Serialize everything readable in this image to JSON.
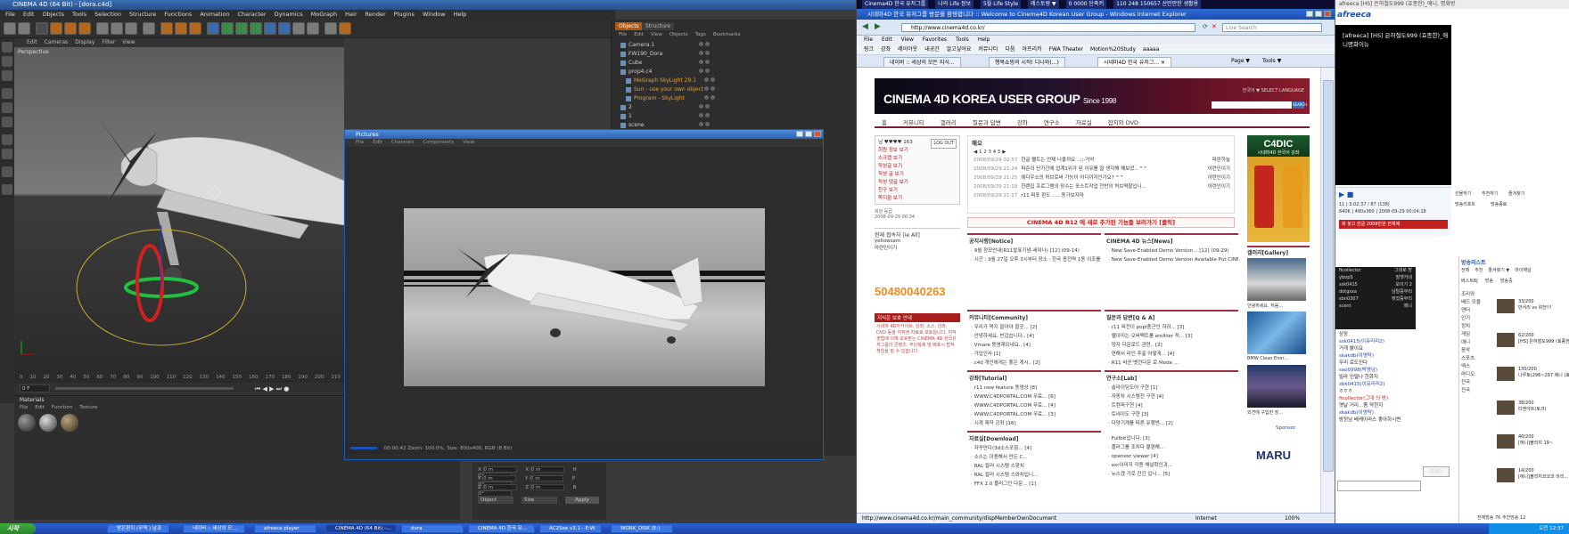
{
  "c4d": {
    "title": "CINEMA 4D (64 Bit) - [dora.c4d]",
    "menu": [
      "File",
      "Edit",
      "Objects",
      "Tools",
      "Selection",
      "Structure",
      "Functions",
      "Animation",
      "Character",
      "Dynamics",
      "MoGraph",
      "Hair",
      "Render",
      "Plugins",
      "Window",
      "Help"
    ],
    "viewport_menu": [
      "Edit",
      "Cameras",
      "Display",
      "Filter",
      "View"
    ],
    "viewport_label": "Perspective",
    "timeline_ticks": [
      "0",
      "10",
      "20",
      "30",
      "40",
      "50",
      "60",
      "70",
      "80",
      "90",
      "100",
      "110",
      "120",
      "130",
      "140",
      "150",
      "160",
      "170",
      "180",
      "190",
      "200",
      "210"
    ],
    "frame_value": "0 F",
    "materials_tab": "Materials",
    "materials_menu": [
      "File",
      "Edit",
      "Function",
      "Texture"
    ],
    "coords": {
      "rows": [
        [
          "X",
          "0 m",
          "X",
          "0 m",
          "H",
          "0°"
        ],
        [
          "Y",
          "0 m",
          "Y",
          "0 m",
          "P",
          "0°"
        ],
        [
          "Z",
          "0 m",
          "Z",
          "0 m",
          "B",
          "0°"
        ]
      ],
      "object_select": "Object",
      "size_select": "Size",
      "apply": "Apply"
    },
    "object_tabs": [
      "Objects",
      "Structure"
    ],
    "object_menu": [
      "File",
      "Edit",
      "View",
      "Objects",
      "Tags",
      "Bookmarks"
    ],
    "objects": [
      {
        "name": "Camera.1",
        "highlight": false
      },
      {
        "name": "FW190_Dora",
        "highlight": false
      },
      {
        "name": "Cube",
        "highlight": false
      },
      {
        "name": "prop4.c4",
        "highlight": false
      },
      {
        "name": "MoGraph SkyLight 29.1",
        "highlight": true
      },
      {
        "name": "Sun - use your own object",
        "highlight": true
      },
      {
        "name": "Program - SkyLight",
        "highlight": true
      },
      {
        "name": "2",
        "highlight": false
      },
      {
        "name": "1",
        "highlight": false
      },
      {
        "name": "scene",
        "highlight": false
      }
    ]
  },
  "pictures": {
    "title": "Pictures",
    "menu": [
      "File",
      "Edit",
      "Channels",
      "Components",
      "View"
    ],
    "status": "00:00:42    Zoom: 100.0%, Size: 800x400, RGB (8 Bit)"
  },
  "ie": {
    "topstrip": [
      "Cinema4D 한국 유저그룹",
      "나의 Life 정보",
      "5월 Life Style",
      "레스토랑 ▼",
      "0 0000 단축키",
      "110 248 150657 산만만한 생활용"
    ],
    "title": "시네마4D 한국 유저그룹 방문을 환영합니다 :: Welcome to Cinema4D Korean User Group - Windows Internet Explorer",
    "address": "http://www.cinema4d.co.kr/",
    "search_placeholder": "Live Search",
    "menu": [
      "File",
      "Edit",
      "View",
      "Favorites",
      "Tools",
      "Help"
    ],
    "favorites": [
      "링크",
      "강좌",
      "레이아웃",
      "내공간",
      "알고싶어요",
      "커뮤니티",
      "다음",
      "아프리카",
      "FWA Theater",
      "Motion%20Study",
      "aaaaa"
    ],
    "tabs": [
      "네이버 :: 세상의 모든 지식...",
      "행복쇼핑의 시작! 디나와(...)",
      "시네마4D 한국 유저그... ✕"
    ],
    "toolbar_right": [
      "Page ▼",
      "Tools ▼"
    ],
    "banner_title": "CINEMA 4D KOREA USER GROUP",
    "banner_since": "Since 1998",
    "banner_select": "한국어 ▼  SELECT LANGUAGE",
    "banner_go": "SEARCH",
    "nav": [
      "홈",
      "커뮤니티",
      "갤러리",
      "질문과 답변",
      "강좌",
      "연구소",
      "자료실",
      "잡지와 DVD"
    ],
    "login": {
      "user_label": "님 ♥♥♥♥ 163",
      "logout": "LOG OUT",
      "items": [
        "회원 정보 보기",
        "스크랩 보기",
        "작성글 보기",
        "작성 글 보기",
        "작성 댓글 보기",
        "친구 보기",
        "쪽지함 보기"
      ],
      "joined": "회원 등급",
      "joined_date": "2008-09-29 00:34"
    },
    "online_title": "현재 접속자 [ie All]",
    "online_users": [
      "yellowsam",
      "아련인이기"
    ],
    "counter": "50480040263",
    "youth_title": "지식은 보호 안내",
    "youth_text": "시네마 4D아카이브, 강좌, 소스, 강좌, DVD 등을 저작권 자료로 보호됩니다. 저작권법에 의해 보호받는 CINEMA 4D 한국유저그룹의 콘텐츠. 무단복제 및 배포시 법적 책임을 질 수 있습니다.",
    "notice": {
      "title": "해오",
      "pages": "◀ 1 2 3 4 5 ▶",
      "rows": [
        {
          "date": "2008/09/29 02:57",
          "text": "한글 펠트는 언제 나올까요 ..;;-거억",
          "author": "파란하늘"
        },
        {
          "date": "2008/09/29 21:24",
          "text": "파준이 단가간에 업계1위가 된 이유를 잘 생각해 해보셨.. ^^",
          "author": "아련인이기"
        },
        {
          "date": "2008/09/29 21:25",
          "text": "에디우소의 허브로써 가능이 어디까지인가요? ^^",
          "author": "아련인이기"
        },
        {
          "date": "2008/09/29 21:19",
          "text": "한랜집 프로그램의 장수는 포스트작업 전반의 허브역할입니...",
          "author": "아련인이기"
        },
        {
          "date": "2008/09/29 21:17",
          "text": "r11 퍼포 판도 ..... 동가보지마",
          "author": ""
        }
      ]
    },
    "red_banner": "CINEMA 4D R12 에 새로 추가된 기능들 보러가기 [클릭]",
    "boxes": [
      {
        "title": "공지사항[Notice]",
        "rows": [
          "9월 정모안내(R11발표기념-세미나) [12] (09-14)",
          "시간 : 9월 27일 오후 3시부터 장소 : 한국 종전략 1동 이조를 방문입니다 4번출구) 도보 5분.."
        ]
      },
      {
        "title": "CINEMA 4D 뉴스[News]",
        "rows": [
          "New Save-Enabled Demo Version... [12] (09-29)",
          "New Save-Enabled Demo Version Available Put CINEMA 4D R11 to..."
        ]
      },
      {
        "title": "커뮤니티[Community]",
        "rows": [
          "우리가 먹지 말아야 할곳... [2]",
          "안녕하세요, 반갑습니다.. [4]",
          "Vmare 동영재되네요.. [4]",
          "가입인사 [1]",
          "c4d 개인에게는 좋은 게시.. [2]"
        ]
      },
      {
        "title": "질문과 답변[Q & A]",
        "rows": [
          "r11 퍼전이 popl충근인 하려... [3]",
          "웹이미는 오버펙트를 emitter 적... [3]",
          "양자 다운로드 관련.. [2]",
          "연해서 라인 추출 어떻게... [4]",
          "R11 바꾼 뱃전다운 로 Mode ..."
        ]
      },
      {
        "title": "강좌[Tutorial]",
        "rows": [
          "r11 new feature 동영상 [8]",
          "WWW.C4DPORTAL.COM 무료... [6]",
          "WWW.C4DPORTAL.COM 무료... [4]",
          "WWW.C4DPORTAL.COM 무료... [3]",
          "시계 제작 강좌 [16]"
        ]
      },
      {
        "title": "연구소[Lab]",
        "rows": [
          "슬라이딩도어 구현 [1]",
          "자동차 시스템전 구현 [4]",
          "트렌퍼구현 [4]",
          "토네이도 구현 [3]",
          "다양기계를 따른 유행엔... [2]"
        ]
      },
      {
        "title": "자료실[Download]",
        "rows": [
          "자꾸만다(3d소스포함... [4]",
          "소스는 이용해서 만든 C... ",
          "RAL 컬러 시스템 스왓치",
          "RAL 컬러 시스템 스와치입니...",
          "FFX 2.0 플러그인 다운... [1]"
        ]
      },
      {
        "title": "",
        "rows": [
          "Fullbit입니다. [3]",
          "플러그를 조치다 불편해...",
          "openexr viewer [4]",
          "exr이미지 각종 채널확인과...",
          "뉴스겠 가로 간간 입니... [5]"
        ]
      }
    ],
    "c4dic_title": "C4DIC",
    "c4dic_sub": "시네마4D 한국어 강좌",
    "gallery_title": "갤러리[Gallery]",
    "gallery_captions": [
      "안녕하세요. 처음...",
      "BMW Clean Ener...",
      "외견에 구입한 장..."
    ],
    "sponsor": "Sponsor",
    "maru": "MARU",
    "status_url": "http://www.cinema4d.co.kr/main_community/dispMemberOwnDocument",
    "status_zone": "Internet",
    "status_zoom": "100%"
  },
  "afreeca": {
    "top": "afreeca [HS] 은하철도999 (효종한)_애니, 명화방",
    "logo": "afreeca",
    "video_title": "[afreeca] [HS] 은하철도999 (효종한)_애니명화이뉴",
    "player_info": [
      "640K | 480x360 | 2008-09-29 00:04:18",
      "11 | 3:02:37 / 87 (138)"
    ],
    "buttons": [
      "선물하기",
      "추천하기",
      "즐겨찾기",
      "방송리포트",
      "방송종료"
    ],
    "notice_red": "화 놓고 한글 2008만원 전체제",
    "chatlist": [
      "ficollector",
      "ybopS",
      "ssk0415",
      "dotgsxa",
      "sbn0307",
      "scent"
    ],
    "chatlist_right": [
      "그대로 방",
      "발젯거네",
      "모이기 2",
      "남탈중무리",
      "맞았증무리",
      "매니"
    ],
    "chat_lines": [
      {
        "c": "",
        "t": "상장"
      },
      {
        "c": "b",
        "t": "ssk0415(이유리리2)"
      },
      {
        "c": "",
        "t": "거게 밝이요"
      },
      {
        "c": "b",
        "t": "skakdb(이영탁)"
      },
      {
        "c": "",
        "t": "우리 로도진다"
      },
      {
        "c": "b",
        "t": "sao0998(박영남)"
      },
      {
        "c": "",
        "t": "빌라 인떨나 한화지"
      },
      {
        "c": "b",
        "t": "sbk0415(이유리리2)"
      },
      {
        "c": "",
        "t": "ㅎㅎㅎ"
      },
      {
        "c": "r",
        "t": "ficollector(그대 의 방)"
      },
      {
        "c": "",
        "t": "옛날 거리...좀 약한지"
      },
      {
        "c": "b",
        "t": "skakdb(이영탁)"
      },
      {
        "c": "",
        "t": "방정남 배케이라스 좋아하시면"
      }
    ],
    "chat_send": "보내기",
    "bcast_title": "방송리스트",
    "bcast_tabs": [
      "전체",
      "추천",
      "즐겨찾기 ▼",
      "마이채널"
    ],
    "bcast_sub": [
      "베스트BJ",
      "방송",
      "방송중"
    ],
    "bcast_items": [
      {
        "n": "33/200",
        "t": "만서리 vs 위전!!!"
      },
      {
        "n": "62/200",
        "t": "[HS] 은하철도999 (효종한) 애니"
      },
      {
        "n": "130/200",
        "t": "나루토(296~297 애니 (효이요없건)"
      },
      {
        "n": "38/200",
        "t": "티엔아트(토크)"
      },
      {
        "n": "40/200",
        "t": "[애니]블리치 19~"
      },
      {
        "n": "14/200",
        "t": "[애니]블리지코코코 마리..."
      }
    ],
    "side_cats": [
      "조리와",
      "배드 모을",
      "엔터",
      "인기",
      "정치",
      "게임",
      "애니",
      "음악",
      "스포츠",
      "엑스",
      "라디오",
      "전국",
      "전국"
    ],
    "footer": "전체방송  76   추천방송  12"
  },
  "taskbar": {
    "start": "시작",
    "tasks": [
      "받은편지 (무역 ) 남과",
      "네이버 :: 세상의 모...",
      "afreeca player",
      "CINEMA 4D (64 Bit) -...",
      "dora",
      "CINEMA 4D 한국 유...",
      "AC2See v3.1 - E:W",
      "WORK_DISK (E:)"
    ],
    "clock": "오전 12:37"
  },
  "colors": {
    "c4d_bg": "#3a3a3a",
    "xp_blue": "#2a5fd1",
    "brand_red": "#7b1d2c",
    "highlight_orange": "#f0a020"
  }
}
